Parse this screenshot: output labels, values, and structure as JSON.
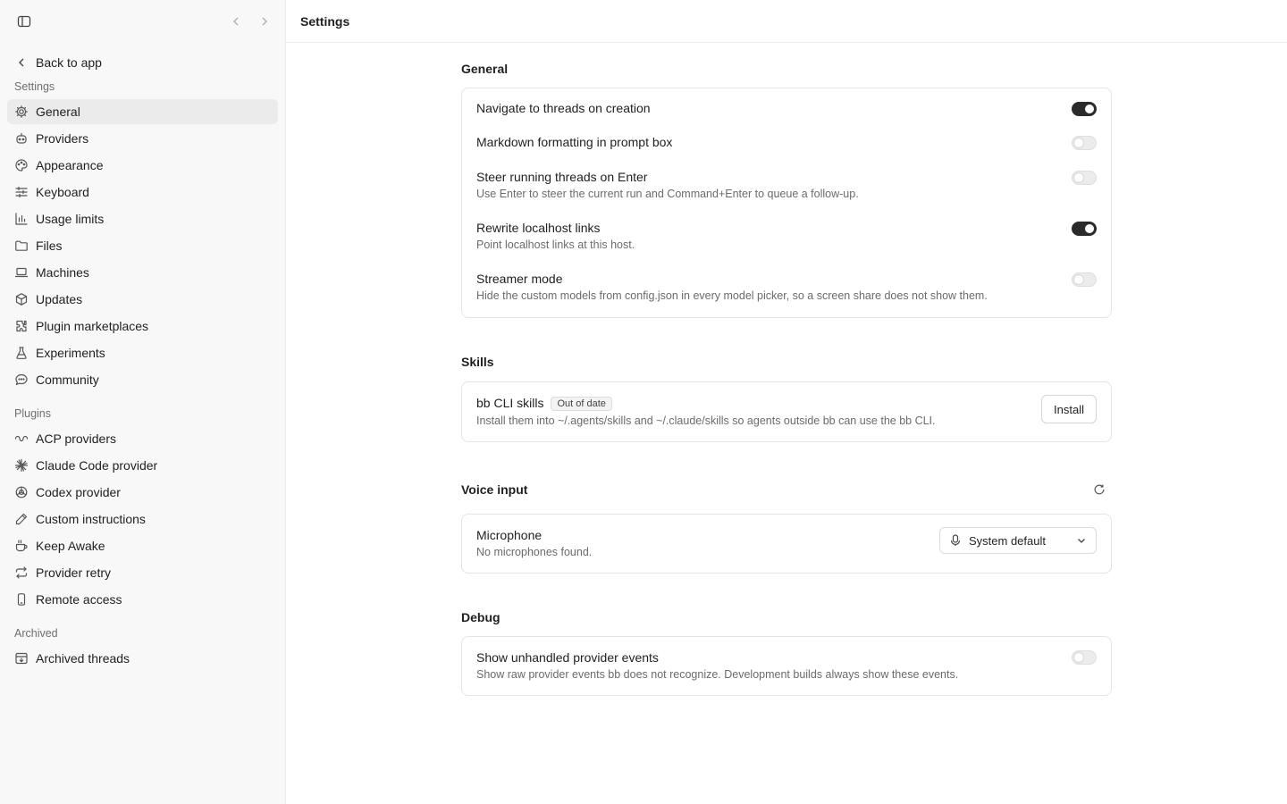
{
  "sidebar": {
    "back_label": "Back to app",
    "groups": [
      {
        "label": "Settings",
        "items": [
          {
            "label": "General",
            "icon": "gear-icon",
            "active": true
          },
          {
            "label": "Providers",
            "icon": "bot-icon"
          },
          {
            "label": "Appearance",
            "icon": "palette-icon"
          },
          {
            "label": "Keyboard",
            "icon": "sliders-icon"
          },
          {
            "label": "Usage limits",
            "icon": "bar-chart-icon"
          },
          {
            "label": "Files",
            "icon": "folder-icon"
          },
          {
            "label": "Machines",
            "icon": "laptop-icon"
          },
          {
            "label": "Updates",
            "icon": "package-icon"
          },
          {
            "label": "Plugin marketplaces",
            "icon": "puzzle-icon"
          },
          {
            "label": "Experiments",
            "icon": "flask-icon"
          },
          {
            "label": "Community",
            "icon": "chat-icon"
          }
        ]
      },
      {
        "label": "Plugins",
        "items": [
          {
            "label": "ACP providers",
            "icon": "link-chain-icon"
          },
          {
            "label": "Claude Code provider",
            "icon": "claude-icon"
          },
          {
            "label": "Codex provider",
            "icon": "codex-icon"
          },
          {
            "label": "Custom instructions",
            "icon": "pencil-icon"
          },
          {
            "label": "Keep Awake",
            "icon": "coffee-icon"
          },
          {
            "label": "Provider retry",
            "icon": "repeat-icon"
          },
          {
            "label": "Remote access",
            "icon": "smartphone-icon"
          }
        ]
      },
      {
        "label": "Archived",
        "items": [
          {
            "label": "Archived threads",
            "icon": "archive-icon"
          }
        ]
      }
    ]
  },
  "header": {
    "title": "Settings"
  },
  "general": {
    "title": "General",
    "rows": [
      {
        "label": "Navigate to threads on creation",
        "desc": "",
        "on": true
      },
      {
        "label": "Markdown formatting in prompt box",
        "desc": "",
        "on": false
      },
      {
        "label": "Steer running threads on Enter",
        "desc": "Use Enter to steer the current run and Command+Enter to queue a follow-up.",
        "on": false
      },
      {
        "label": "Rewrite localhost links",
        "desc": "Point localhost links at this host.",
        "on": true
      },
      {
        "label": "Streamer mode",
        "desc": "Hide the custom models from config.json in every model picker, so a screen share does not show them.",
        "on": false
      }
    ]
  },
  "skills": {
    "title": "Skills",
    "label": "bb CLI skills",
    "badge": "Out of date",
    "desc": "Install them into ~/.agents/skills and ~/.claude/skills so agents outside bb can use the bb CLI.",
    "button": "Install"
  },
  "voice": {
    "title": "Voice input",
    "label": "Microphone",
    "desc": "No microphones found.",
    "selected": "System default"
  },
  "debug": {
    "title": "Debug",
    "label": "Show unhandled provider events",
    "desc": "Show raw provider events bb does not recognize. Development builds always show these events.",
    "on": false
  }
}
